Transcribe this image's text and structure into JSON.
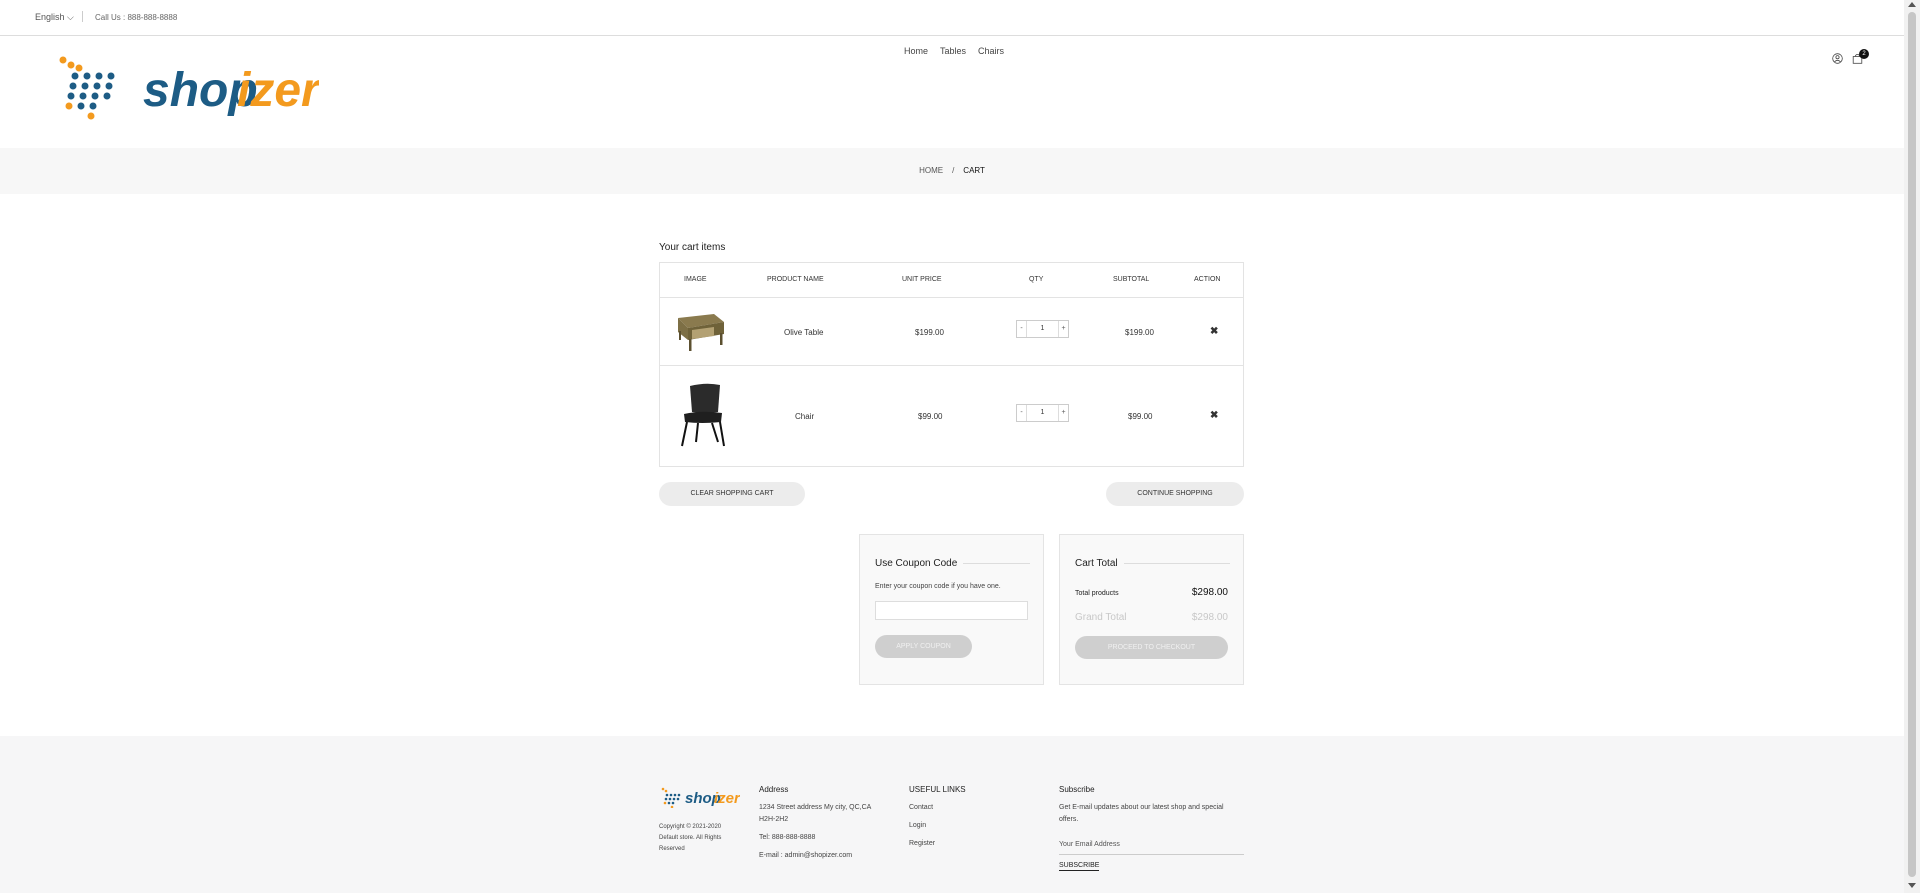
{
  "topbar": {
    "language": "English ⌵",
    "phone": "Call Us : 888-888-8888"
  },
  "header": {
    "logo_part1": "shop",
    "logo_part2": "izer",
    "nav": [
      "Home",
      "Tables",
      "Chairs"
    ],
    "cart_count": "2",
    "colors": {
      "logo_blue": "#1d5c85",
      "logo_orange": "#f39a1e"
    }
  },
  "breadcrumb": {
    "home": "HOME",
    "separator": "/",
    "current": "CART"
  },
  "cart": {
    "title": "Your cart items",
    "columns": [
      "IMAGE",
      "PRODUCT NAME",
      "UNIT PRICE",
      "QTY",
      "SUBTOTAL",
      "ACTION"
    ],
    "items": [
      {
        "name": "Olive Table",
        "unit_price": "$199.00",
        "qty": "1",
        "subtotal": "$199.00",
        "image": "table-image"
      },
      {
        "name": "Chair",
        "unit_price": "$99.00",
        "qty": "1",
        "subtotal": "$99.00",
        "image": "chair-image"
      }
    ],
    "qty_minus": "-",
    "qty_plus": "+",
    "remove_glyph": "✖",
    "clear_label": "CLEAR SHOPPING CART",
    "continue_label": "CONTINUE SHOPPING"
  },
  "coupon": {
    "title": "Use Coupon Code",
    "hint": "Enter your coupon code if you have one.",
    "input_value": "",
    "apply_label": "APPLY COUPON"
  },
  "totals": {
    "title": "Cart Total",
    "products_label": "Total products",
    "products_value": "$298.00",
    "grand_label": "Grand Total",
    "grand_value": "$298.00",
    "checkout_label": "PROCEED TO CHECKOUT"
  },
  "footer": {
    "copyright": "Copyright © 2021-2020 Default store. All Rights Reserved",
    "address": {
      "heading": "Address",
      "line1": "1234 Street address My city, QC,CA H2H-2H2",
      "tel": "Tel: 888-888-8888",
      "email": "E-mail : admin@shopizer.com"
    },
    "links": {
      "heading": "USEFUL LINKS",
      "items": [
        "Contact",
        "Login",
        "Register"
      ]
    },
    "subscribe": {
      "heading": "Subscribe",
      "text": "Get E-mail updates about our latest shop and special offers.",
      "placeholder": "Your Email Address",
      "button": "SUBSCRIBE"
    }
  }
}
